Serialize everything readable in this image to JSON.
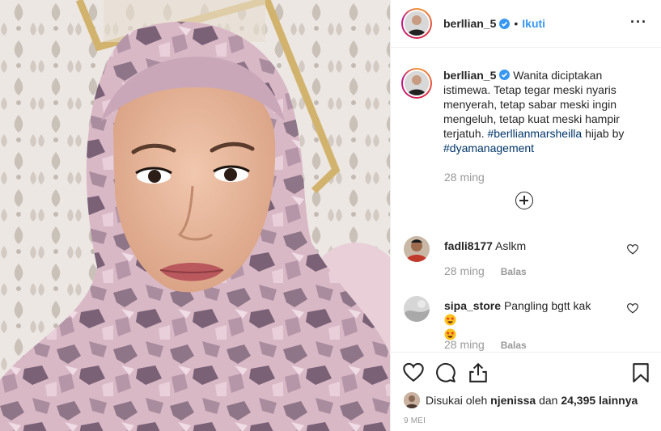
{
  "post": {
    "image_alt": "selfie in a lilac camouflage-print hijab",
    "author": {
      "username": "berllian_5",
      "follow_label": "Ikuti",
      "separator": "•",
      "more_label": "···"
    },
    "caption": {
      "username": "berllian_5",
      "text": "Wanita diciptakan istimewa. Tetap tegar meski nyaris menyerah, tetap sabar meski ingin mengeluh, tetap kuat meski hampir terjatuh.",
      "hashtag_1": "#berllianmarsheilla",
      "middle": "hijab by",
      "hashtag_2": "#dyamanagement",
      "time": "28 ming"
    },
    "comments": [
      {
        "username": "fadli8177",
        "text": "Aslkm",
        "time": "28 ming",
        "reply": "Balas"
      },
      {
        "username": "sipa_store",
        "text": "Pangling bgtt kak",
        "time": "28 ming",
        "reply": "Balas",
        "emoji": "star-struck"
      }
    ],
    "likes": {
      "prefix": "Disukai oleh",
      "user": "njenissa",
      "conj": "dan",
      "count": "24,395 lainnya"
    },
    "date": "9 MEI"
  },
  "colors": {
    "link": "#3897f0",
    "hashtag": "#003569",
    "muted": "#999999",
    "text": "#262626",
    "border": "#efefef"
  },
  "icons": [
    "verified-badge-icon",
    "more-options-icon",
    "load-more-icon",
    "heart-icon",
    "comment-icon",
    "share-icon",
    "bookmark-icon"
  ]
}
